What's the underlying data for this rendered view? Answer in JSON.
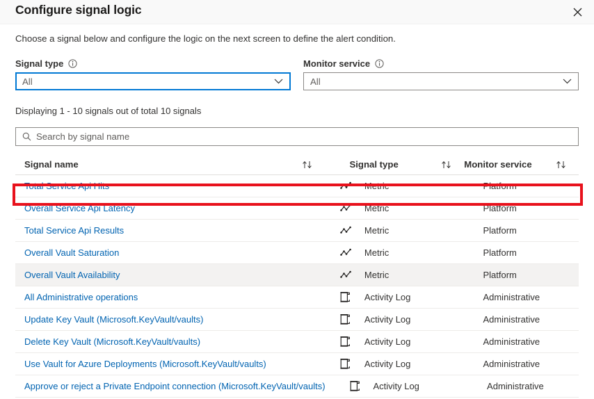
{
  "header": {
    "title": "Configure signal logic",
    "close_icon": "close-icon"
  },
  "subtitle": "Choose a signal below and configure the logic on the next screen to define the alert condition.",
  "filters": [
    {
      "label": "Signal type",
      "info_icon": "info-icon",
      "value": "All",
      "focused": true
    },
    {
      "label": "Monitor service",
      "info_icon": "info-icon",
      "value": "All",
      "focused": false
    }
  ],
  "count_text": "Displaying 1 - 10 signals out of total 10 signals",
  "search": {
    "placeholder": "Search by signal name",
    "value": "",
    "icon": "search-icon"
  },
  "table": {
    "columns": [
      {
        "label": "Signal name",
        "sort_icon": "sort-updown-icon"
      },
      {
        "label": "Signal type",
        "sort_icon": "sort-updown-icon"
      },
      {
        "label": "Monitor service",
        "sort_icon": "sort-updown-icon"
      }
    ],
    "rows": [
      {
        "name": "Total Service Api Hits",
        "icon": "metric-line-chart-icon",
        "type": "Metric",
        "service": "Platform",
        "hovered": false,
        "highlighted": false
      },
      {
        "name": "Overall Service Api Latency",
        "icon": "metric-line-chart-icon",
        "type": "Metric",
        "service": "Platform",
        "hovered": false,
        "highlighted": true
      },
      {
        "name": "Total Service Api Results",
        "icon": "metric-line-chart-icon",
        "type": "Metric",
        "service": "Platform",
        "hovered": false,
        "highlighted": false
      },
      {
        "name": "Overall Vault Saturation",
        "icon": "metric-line-chart-icon",
        "type": "Metric",
        "service": "Platform",
        "hovered": false,
        "highlighted": false
      },
      {
        "name": "Overall Vault Availability",
        "icon": "metric-line-chart-icon",
        "type": "Metric",
        "service": "Platform",
        "hovered": true,
        "highlighted": false
      },
      {
        "name": "All Administrative operations",
        "icon": "activity-log-scroll-icon",
        "type": "Activity Log",
        "service": "Administrative",
        "hovered": false,
        "highlighted": false
      },
      {
        "name": "Update Key Vault (Microsoft.KeyVault/vaults)",
        "icon": "activity-log-scroll-icon",
        "type": "Activity Log",
        "service": "Administrative",
        "hovered": false,
        "highlighted": false
      },
      {
        "name": "Delete Key Vault (Microsoft.KeyVault/vaults)",
        "icon": "activity-log-scroll-icon",
        "type": "Activity Log",
        "service": "Administrative",
        "hovered": false,
        "highlighted": false
      },
      {
        "name": "Use Vault for Azure Deployments (Microsoft.KeyVault/vaults)",
        "icon": "activity-log-scroll-icon",
        "type": "Activity Log",
        "service": "Administrative",
        "hovered": false,
        "highlighted": false
      },
      {
        "name": "Approve or reject a Private Endpoint connection (Microsoft.KeyVault/vaults)",
        "icon": "activity-log-scroll-icon",
        "type": "Activity Log",
        "service": "Administrative",
        "hovered": false,
        "highlighted": false
      }
    ]
  },
  "colors": {
    "link": "#0063b1",
    "focus_border": "#0078d4",
    "annotation": "#e8111c",
    "hover_row": "#f3f2f1"
  }
}
